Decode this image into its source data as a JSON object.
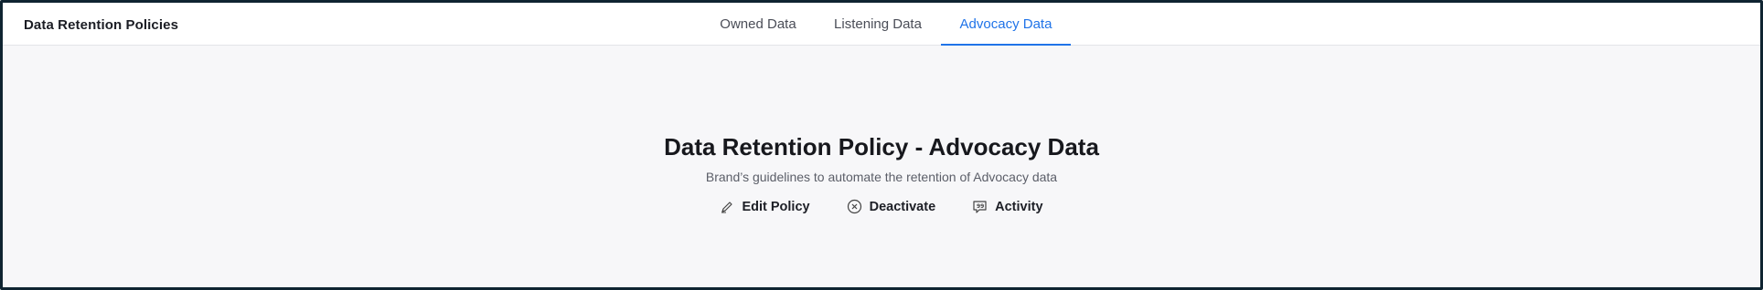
{
  "header": {
    "title": "Data Retention Policies"
  },
  "tabs": [
    {
      "label": "Owned Data",
      "active": false
    },
    {
      "label": "Listening Data",
      "active": false
    },
    {
      "label": "Advocacy Data",
      "active": true
    }
  ],
  "policy": {
    "title": "Data Retention Policy - Advocacy Data",
    "subtitle": "Brand’s guidelines to automate the retention of Advocacy data"
  },
  "actions": [
    {
      "label": "Edit Policy",
      "icon": "pencil-icon"
    },
    {
      "label": "Deactivate",
      "icon": "close-circle-icon"
    },
    {
      "label": "Activity",
      "icon": "chat-bubble-icon"
    }
  ],
  "colors": {
    "accent": "#1f73e8",
    "background": "#f7f7f9",
    "border": "#0f2431"
  }
}
